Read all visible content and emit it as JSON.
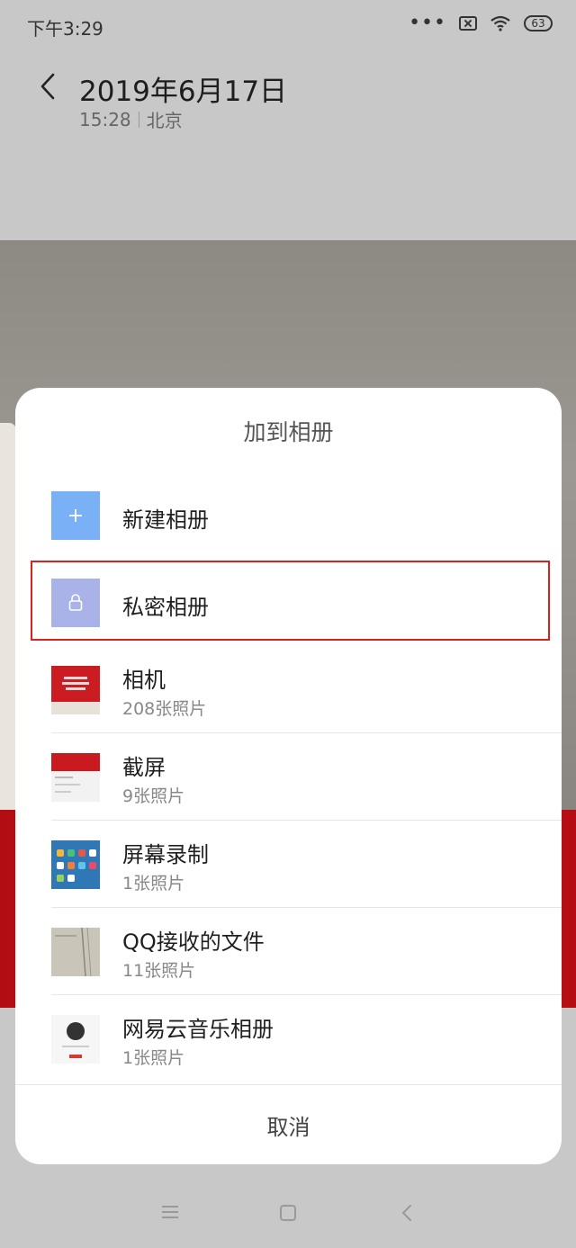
{
  "status_bar": {
    "time": "下午3:29",
    "battery": "63",
    "dots": "•••"
  },
  "header": {
    "title": "2019年6月17日",
    "time": "15:28",
    "location": "北京"
  },
  "sheet": {
    "title": "加到相册",
    "items": [
      {
        "name": "新建相册",
        "icon": "plus-icon"
      },
      {
        "name": "私密相册",
        "icon": "lock-icon"
      },
      {
        "name": "相机",
        "count": "208张照片"
      },
      {
        "name": "截屏",
        "count": "9张照片"
      },
      {
        "name": "屏幕录制",
        "count": "1张照片"
      },
      {
        "name": "QQ接收的文件",
        "count": "11张照片"
      },
      {
        "name": "网易云音乐相册",
        "count": "1张照片"
      }
    ],
    "cancel_label": "取消"
  },
  "colors": {
    "accent_blue": "#7ab0f5",
    "private_purple": "#aab3e8",
    "highlight_red": "#d9221e"
  }
}
